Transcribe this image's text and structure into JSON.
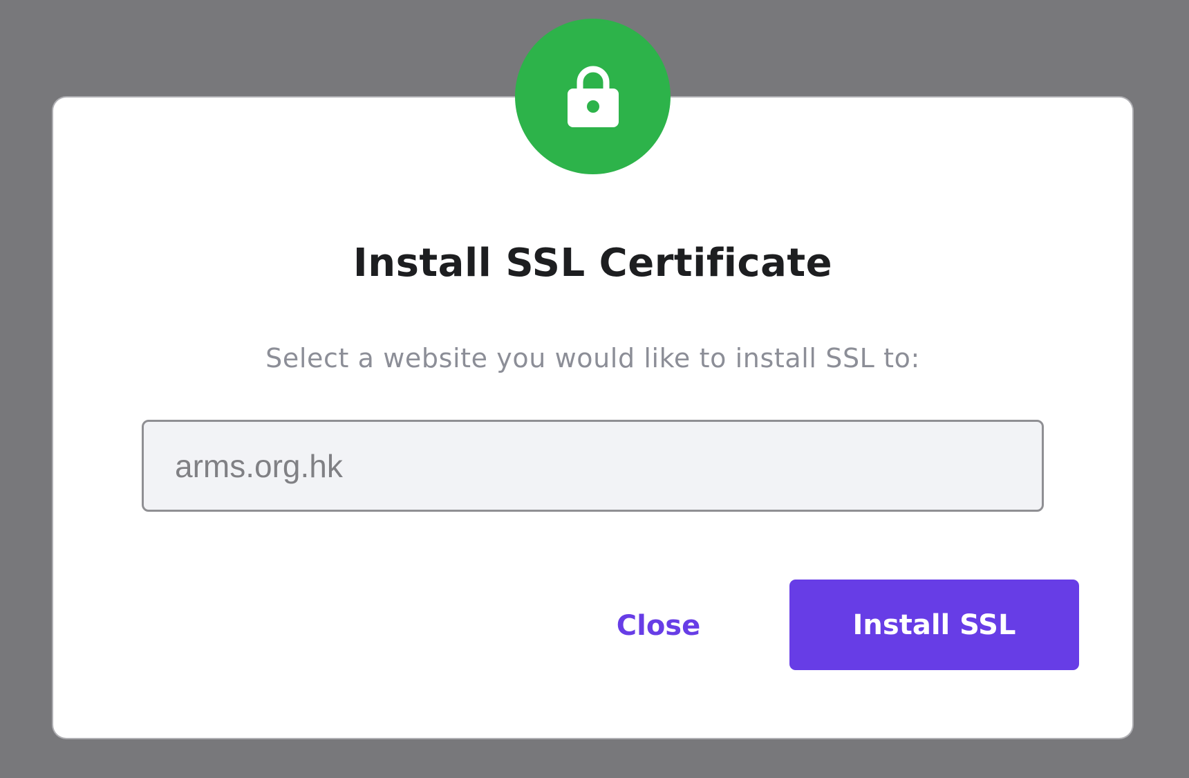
{
  "colors": {
    "backdrop": "#78787b",
    "modal_background": "#ffffff",
    "icon_circle": "#2db34a",
    "accent": "#673de6",
    "title_text": "#1d1e20",
    "subtitle_text": "#8c8e97",
    "field_background": "#f2f3f6"
  },
  "modal": {
    "icon": "lock-icon",
    "title": "Install SSL Certificate",
    "subtitle": "Select a website you would like to install SSL to:",
    "website_field": {
      "value": "arms.org.hk"
    },
    "actions": {
      "close_label": "Close",
      "install_label": "Install SSL"
    }
  }
}
